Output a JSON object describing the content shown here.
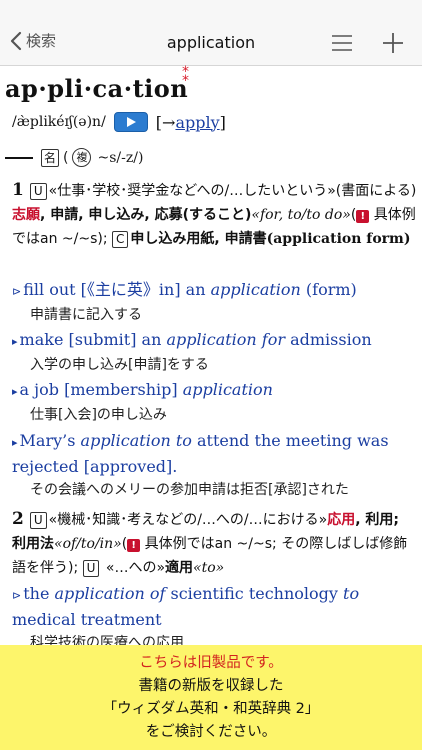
{
  "nav": {
    "back_label": "検索",
    "title": "application"
  },
  "entry": {
    "headword": "ap·pli·ca·tion",
    "headword_mark": "*\n*",
    "pronunciation": "/æ̀plikéɪʃ(ə)n/",
    "crossref_arrow": "[→",
    "crossref_link": "apply",
    "crossref_close": "]",
    "pos_label": "名",
    "pos_open": "(",
    "plural_label": "複",
    "plural_form": "~s/-z/)",
    "sense1": {
      "number": "1",
      "u": "U",
      "text_a": "«仕事･学校･奨学金などへの/…したいという»(書面による)",
      "red_a": "志願",
      "text_b": ", 申請, 申し込み, 応募(すること)",
      "pattern": "«for, to/to do»",
      "open": "(",
      "excl": "!",
      "text_c": " 具体例ではan ~/~s); ",
      "c": "C",
      "text_d": "申し込み用紙, 申請書",
      "text_e": "(application form)"
    },
    "examples": [
      {
        "prefix": "⊳",
        "en_a": "fill out [《主に英》in] an ",
        "en_i": "application",
        "en_b": " (form)",
        "ja": "申請書に記入する"
      },
      {
        "prefix": "▸",
        "en_a": "make [submit] an ",
        "en_i": "application for",
        "en_b": " admission",
        "ja": "入学の申し込み[申請]をする"
      },
      {
        "prefix": "▸",
        "en_a": "a job [membership] ",
        "en_i": "application",
        "en_b": "",
        "ja": "仕事[入会]の申し込み"
      },
      {
        "prefix": "▸",
        "en_a": "Mary’s ",
        "en_i": "application to",
        "en_b": " attend the meeting was rejected [approved].",
        "ja": "その会議へのメリーの参加申請は拒否[承認]された"
      },
      {
        "prefix": "⊳",
        "en_a": "the ",
        "en_i": "application of",
        "en_b": " scientific technology ",
        "en_i2": "to",
        "en_c": " medical treatment",
        "ja": "科学技術の医療への応用"
      }
    ],
    "sense2": {
      "number": "2",
      "u": "U",
      "text_a": "«機械･知識･考えなどの/…への/…における»",
      "red_a": "応用",
      "text_b": ", 利用; 利用法",
      "pattern": "«of/to/in»",
      "open": "(",
      "excl": "!",
      "text_c": " 具体例ではan ~/~s; その際しばしば修飾語を伴う); ",
      "u2": "U",
      "text_d": " «…への»",
      "text_e": "適用",
      "pattern2": "«to»"
    }
  },
  "banner": {
    "line1": "こちらは旧製品です。",
    "line2": "書籍の新版を収録した",
    "line3": "「ウィズダム英和・和英辞典 2」",
    "line4": "をご検討ください。"
  }
}
